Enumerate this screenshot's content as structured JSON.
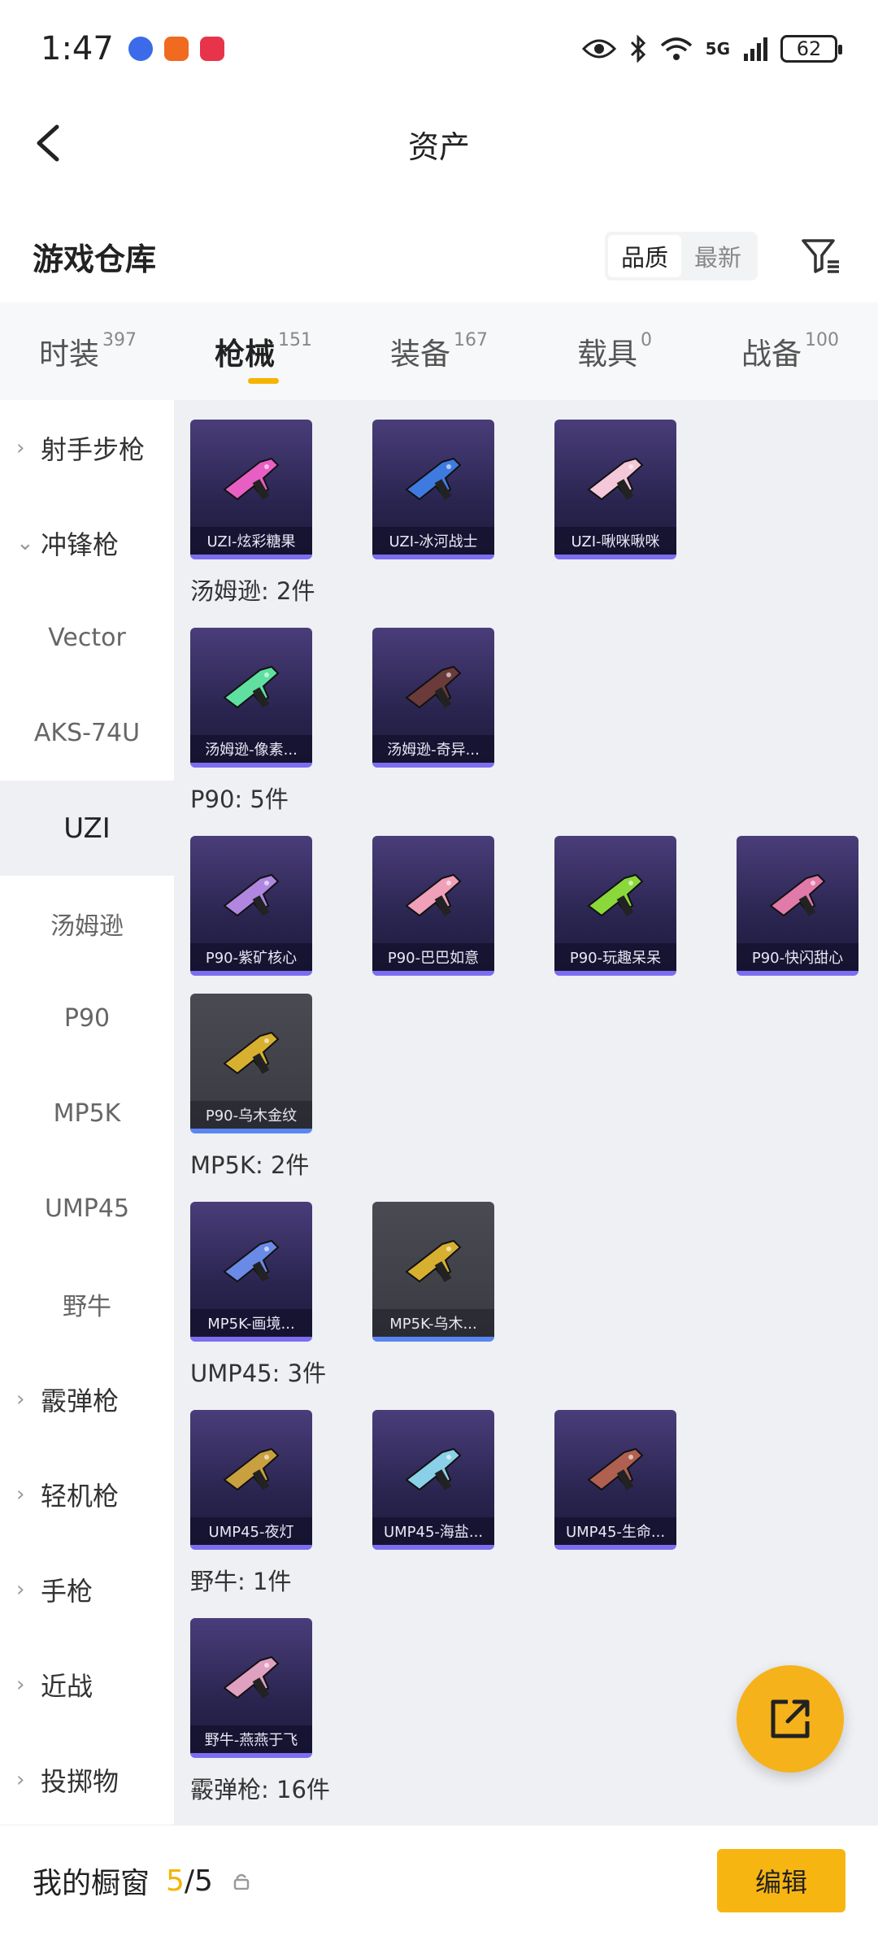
{
  "status": {
    "time": "1:47",
    "network": "5G",
    "battery": "62"
  },
  "header": {
    "title": "资产"
  },
  "section": {
    "title": "游戏仓库",
    "sort_options": [
      "品质",
      "最新"
    ],
    "sort_selected": "品质"
  },
  "tabs": [
    {
      "label": "时装",
      "count": "397"
    },
    {
      "label": "枪械",
      "count": "151"
    },
    {
      "label": "装备",
      "count": "167"
    },
    {
      "label": "载具",
      "count": "0"
    },
    {
      "label": "战备",
      "count": "100"
    }
  ],
  "sidebar": {
    "items": [
      {
        "label": "射手步枪",
        "type": "category",
        "expanded": false
      },
      {
        "label": "冲锋枪",
        "type": "category",
        "expanded": true
      },
      {
        "label": "Vector",
        "type": "sub"
      },
      {
        "label": "AKS-74U",
        "type": "sub"
      },
      {
        "label": "UZI",
        "type": "sub",
        "selected": true
      },
      {
        "label": "汤姆逊",
        "type": "sub"
      },
      {
        "label": "P90",
        "type": "sub"
      },
      {
        "label": "MP5K",
        "type": "sub"
      },
      {
        "label": "UMP45",
        "type": "sub"
      },
      {
        "label": "野牛",
        "type": "sub"
      },
      {
        "label": "霰弹枪",
        "type": "category",
        "expanded": false
      },
      {
        "label": "轻机枪",
        "type": "category",
        "expanded": false
      },
      {
        "label": "手枪",
        "type": "category",
        "expanded": false
      },
      {
        "label": "近战",
        "type": "category",
        "expanded": false
      },
      {
        "label": "投掷物",
        "type": "category",
        "expanded": false
      }
    ]
  },
  "groups": [
    {
      "label": "",
      "items": [
        {
          "name": "UZI-炫彩糖果",
          "gun_color": "#e85fc4"
        },
        {
          "name": "UZI-冰河战士",
          "gun_color": "#3f7ae0"
        },
        {
          "name": "UZI-啾咪啾咪",
          "gun_color": "#f4c8d8"
        }
      ]
    },
    {
      "label": "汤姆逊: 2件",
      "items": [
        {
          "name": "汤姆逊-像素...",
          "gun_color": "#5fe0a0"
        },
        {
          "name": "汤姆逊-奇异...",
          "gun_color": "#6b3a3a"
        }
      ]
    },
    {
      "label": "P90: 5件",
      "items": [
        {
          "name": "P90-紫矿核心",
          "gun_color": "#b086e0"
        },
        {
          "name": "P90-巴巴如意",
          "gun_color": "#f0a0b8"
        },
        {
          "name": "P90-玩趣呆呆",
          "gun_color": "#8ad83a"
        },
        {
          "name": "P90-快闪甜心",
          "gun_color": "#e07aa8"
        },
        {
          "name": "P90-乌木金纹",
          "gun_color": "#d8b030",
          "gray": true
        }
      ]
    },
    {
      "label": "MP5K: 2件",
      "items": [
        {
          "name": "MP5K-画境...",
          "gun_color": "#6a8ae8"
        },
        {
          "name": "MP5K-乌木...",
          "gun_color": "#d8b030",
          "gray": true
        }
      ]
    },
    {
      "label": "UMP45: 3件",
      "items": [
        {
          "name": "UMP45-夜灯",
          "gun_color": "#c8a040"
        },
        {
          "name": "UMP45-海盐...",
          "gun_color": "#8ad0e8"
        },
        {
          "name": "UMP45-生命...",
          "gun_color": "#b06050"
        }
      ]
    },
    {
      "label": "野牛: 1件",
      "items": [
        {
          "name": "野牛-燕燕于飞",
          "gun_color": "#e0a0c0"
        }
      ]
    },
    {
      "label": "霰弹枪: 16件",
      "items": []
    }
  ],
  "bottom": {
    "label": "我的橱窗",
    "current": "5",
    "total": "/5",
    "edit_label": "编辑"
  },
  "colors": {
    "accent": "#f5b400",
    "card_border": "#7b6ef0",
    "fab": "#f6b21b"
  }
}
